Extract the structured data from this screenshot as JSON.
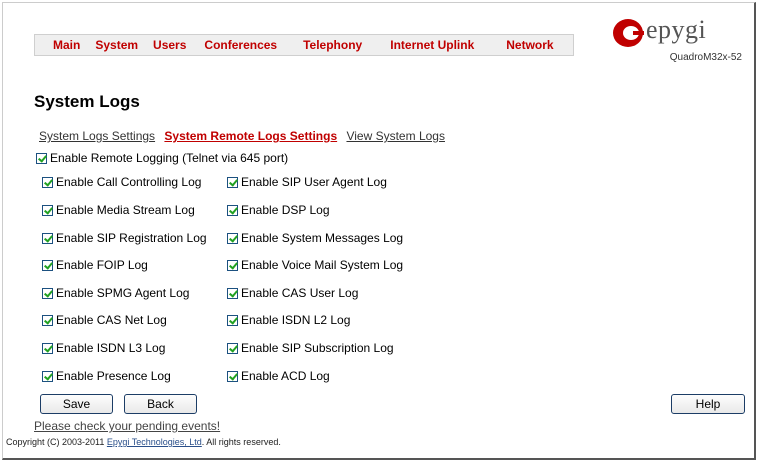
{
  "nav": {
    "items": [
      "Main",
      "System",
      "Users",
      "Conferences",
      "Telephony",
      "Internet Uplink",
      "Network"
    ]
  },
  "logo": {
    "word": "epygi",
    "model": "QuadroM32x-52"
  },
  "page_title": "System Logs",
  "tabs": [
    "System Logs Settings",
    "System Remote Logs Settings",
    "View System Logs"
  ],
  "remote_logging": {
    "label": "Enable Remote Logging (Telnet via 645 port)",
    "checked": true
  },
  "logs_left": [
    {
      "label": "Enable Call Controlling Log",
      "checked": true
    },
    {
      "label": "Enable Media Stream Log",
      "checked": true
    },
    {
      "label": "Enable SIP Registration Log",
      "checked": true
    },
    {
      "label": "Enable FOIP Log",
      "checked": true
    },
    {
      "label": "Enable SPMG Agent Log",
      "checked": true
    },
    {
      "label": "Enable CAS Net Log",
      "checked": true
    },
    {
      "label": "Enable ISDN L3 Log",
      "checked": true
    },
    {
      "label": "Enable Presence Log",
      "checked": true
    }
  ],
  "logs_right": [
    {
      "label": "Enable SIP User Agent Log",
      "checked": true
    },
    {
      "label": "Enable DSP Log",
      "checked": true
    },
    {
      "label": "Enable System Messages Log",
      "checked": true
    },
    {
      "label": "Enable Voice Mail System Log",
      "checked": true
    },
    {
      "label": "Enable CAS User Log",
      "checked": true
    },
    {
      "label": "Enable ISDN L2 Log",
      "checked": true
    },
    {
      "label": "Enable SIP Subscription Log",
      "checked": true
    },
    {
      "label": "Enable ACD Log",
      "checked": true
    }
  ],
  "buttons": {
    "save": "Save",
    "back": "Back",
    "help": "Help"
  },
  "pending": "Please check your pending events!",
  "copyright": {
    "prefix": "Copyright (C) 2003-2011 ",
    "link": "Epygi Technologies, Ltd",
    "suffix": ". All rights reserved."
  },
  "colors": {
    "accent": "#c00000",
    "check": "#21a121",
    "logo": "#c00000"
  }
}
